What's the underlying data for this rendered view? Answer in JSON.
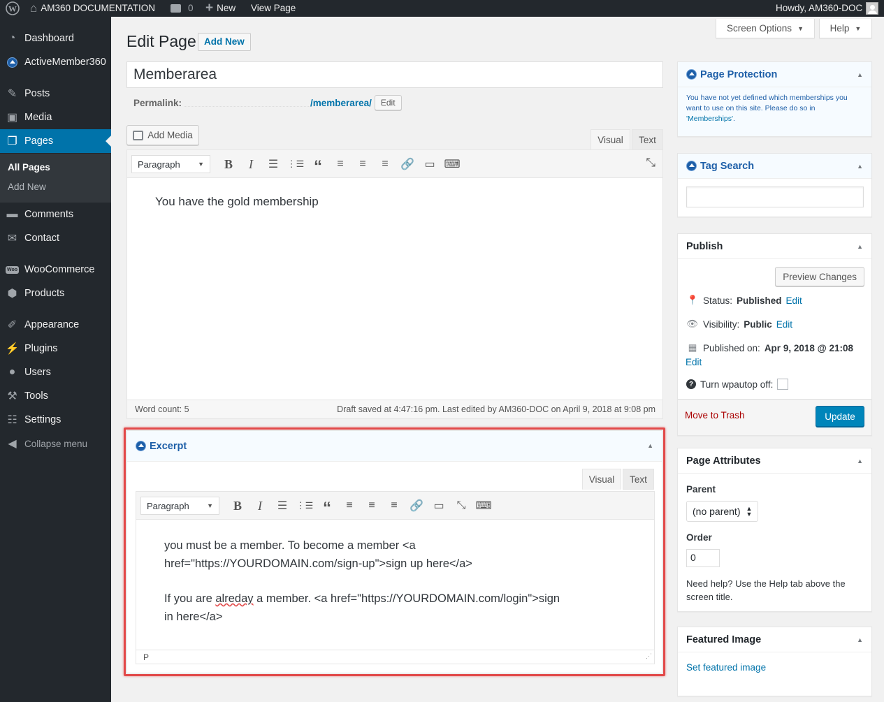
{
  "adminbar": {
    "site_name": "AM360 DOCUMENTATION",
    "comments_count": "0",
    "new_label": "New",
    "view_page": "View Page",
    "howdy": "Howdy, AM360-DOC"
  },
  "sidebar": {
    "items": [
      {
        "label": "Dashboard",
        "icon": "dashboard-icon"
      },
      {
        "label": "ActiveMember360",
        "icon": "activemember-icon"
      },
      {
        "label": "Posts",
        "icon": "pin-icon"
      },
      {
        "label": "Media",
        "icon": "media-icon"
      },
      {
        "label": "Pages",
        "icon": "pages-icon"
      },
      {
        "label": "Comments",
        "icon": "comment-icon"
      },
      {
        "label": "Contact",
        "icon": "mail-icon"
      },
      {
        "label": "WooCommerce",
        "icon": "woo-icon"
      },
      {
        "label": "Products",
        "icon": "box-icon"
      },
      {
        "label": "Appearance",
        "icon": "brush-icon"
      },
      {
        "label": "Plugins",
        "icon": "plug-icon"
      },
      {
        "label": "Users",
        "icon": "user-icon"
      },
      {
        "label": "Tools",
        "icon": "wrench-icon"
      },
      {
        "label": "Settings",
        "icon": "sliders-icon"
      },
      {
        "label": "Collapse menu",
        "icon": "collapse-icon"
      }
    ],
    "submenu": {
      "all_pages": "All Pages",
      "add_new": "Add New"
    }
  },
  "screen_options": "Screen Options",
  "help": "Help",
  "page": {
    "heading": "Edit Page",
    "add_new": "Add New",
    "title_value": "Memberarea",
    "permalink_label": "Permalink:",
    "permalink_slug": "/memberarea/",
    "permalink_edit": "Edit"
  },
  "editor": {
    "add_media": "Add Media",
    "tab_visual": "Visual",
    "tab_text": "Text",
    "format": "Paragraph",
    "content": "You have the gold membership",
    "word_count": "Word count: 5",
    "draft_status": "Draft saved at 4:47:16 pm. Last edited by AM360-DOC on April 9, 2018 at 9:08 pm"
  },
  "excerpt": {
    "title": "Excerpt",
    "tab_visual": "Visual",
    "tab_text": "Text",
    "format": "Paragraph",
    "line1": "you must be a member. To become a member <a",
    "line2": "href=\"https://YOURDOMAIN.com/sign-up\">sign up here</a>",
    "line3a": "If you are ",
    "line3b": "alreday",
    "line3c": " a member. <a href=\"https://YOURDOMAIN.com/login\">sign",
    "line4": "in here</a>",
    "path": "P"
  },
  "protection": {
    "title": "Page Protection",
    "text": "You have not yet defined which memberships you want to use on this site. Please do so in ",
    "link": "'Memberships'",
    "end": "."
  },
  "tag_search": {
    "title": "Tag Search",
    "value": ""
  },
  "publish": {
    "title": "Publish",
    "preview": "Preview Changes",
    "status_label": "Status:",
    "status_value": "Published",
    "visibility_label": "Visibility:",
    "visibility_value": "Public",
    "published_label": "Published on:",
    "published_value": "Apr 9, 2018 @ 21:08",
    "edit": "Edit",
    "wpautop": "Turn wpautop off:",
    "trash": "Move to Trash",
    "update": "Update"
  },
  "attributes": {
    "title": "Page Attributes",
    "parent_label": "Parent",
    "parent_value": "(no parent)",
    "order_label": "Order",
    "order_value": "0",
    "help": "Need help? Use the Help tab above the screen title."
  },
  "featured": {
    "title": "Featured Image",
    "link": "Set featured image"
  },
  "colors": {
    "accent": "#0073aa",
    "highlight": "#e24a4a",
    "sidebar": "#23282d"
  }
}
